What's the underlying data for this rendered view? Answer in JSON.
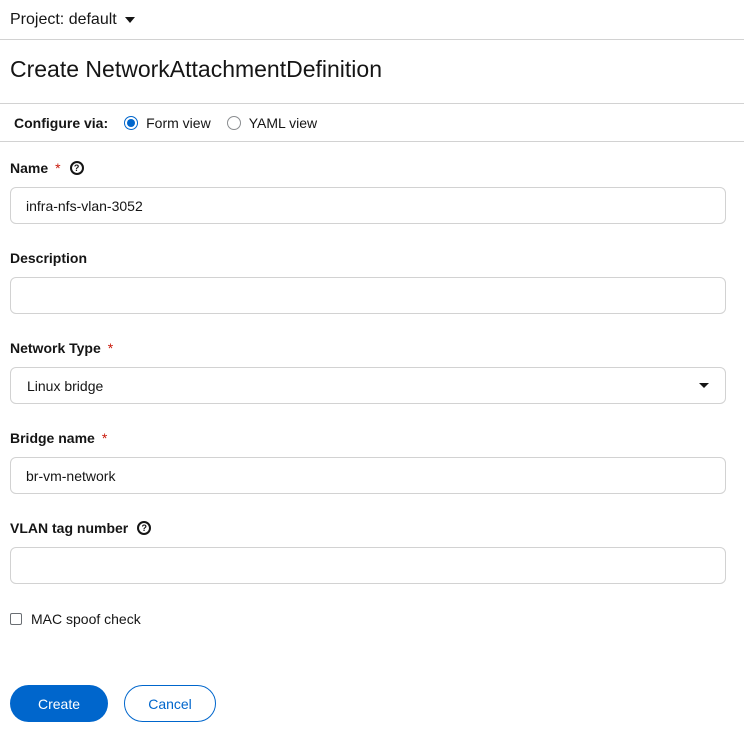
{
  "project": {
    "label": "Project: default",
    "caret_icon": "caret-down-icon"
  },
  "page": {
    "title": "Create NetworkAttachmentDefinition"
  },
  "configure": {
    "label": "Configure via:",
    "options": [
      {
        "label": "Form view",
        "selected": true
      },
      {
        "label": "YAML view",
        "selected": false
      }
    ]
  },
  "form": {
    "name": {
      "label": "Name",
      "required": "*",
      "value": "infra-nfs-vlan-3052",
      "help_icon": "help-icon"
    },
    "description": {
      "label": "Description",
      "value": ""
    },
    "network_type": {
      "label": "Network Type",
      "required": "*",
      "value": "Linux bridge"
    },
    "bridge_name": {
      "label": "Bridge name",
      "required": "*",
      "value": "br-vm-network"
    },
    "vlan_tag": {
      "label": "VLAN tag number",
      "value": "",
      "help_icon": "help-icon"
    },
    "mac_spoof": {
      "label": "MAC spoof check",
      "checked": false
    }
  },
  "actions": {
    "create_label": "Create",
    "cancel_label": "Cancel"
  },
  "colors": {
    "primary": "#0066cc",
    "required": "#c9190b",
    "border": "#d2d2d2"
  }
}
